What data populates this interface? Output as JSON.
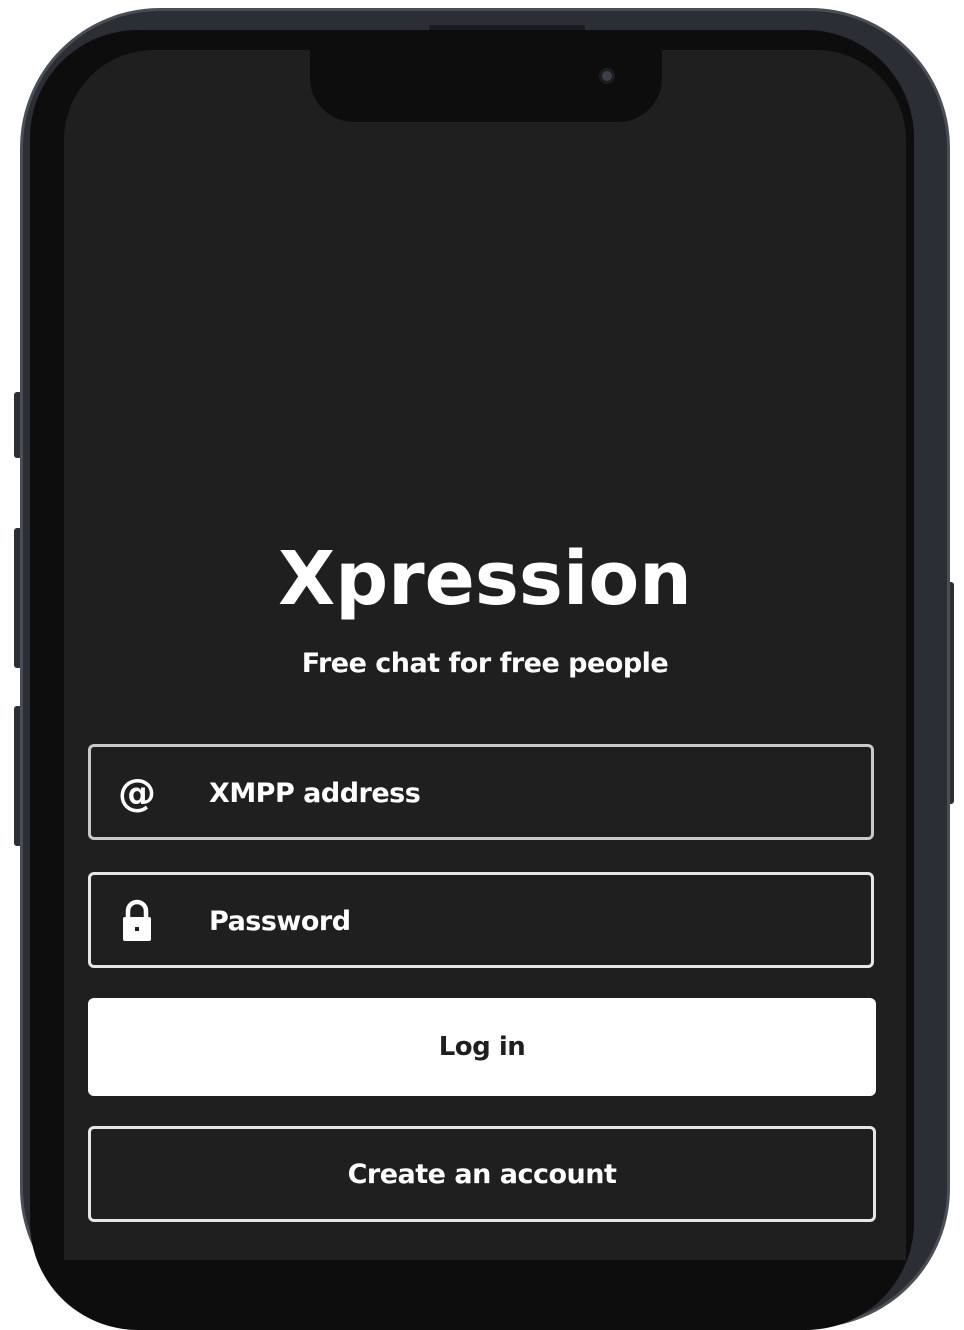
{
  "app": {
    "title": "Xpression",
    "tagline": "Free chat for free people"
  },
  "login_form": {
    "address_field": {
      "icon": "at-sign-icon",
      "placeholder": "XMPP address",
      "value": ""
    },
    "password_field": {
      "icon": "lock-icon",
      "placeholder": "Password",
      "value": ""
    },
    "login_button_label": "Log in",
    "create_account_button_label": "Create an account"
  },
  "colors": {
    "background": "#1f1f1f",
    "text": "#ffffff",
    "field_border": "#c9c9c9",
    "primary_button_bg": "#ffffff",
    "primary_button_text": "#1f1f1f",
    "device_frame": "#2b2e34"
  }
}
